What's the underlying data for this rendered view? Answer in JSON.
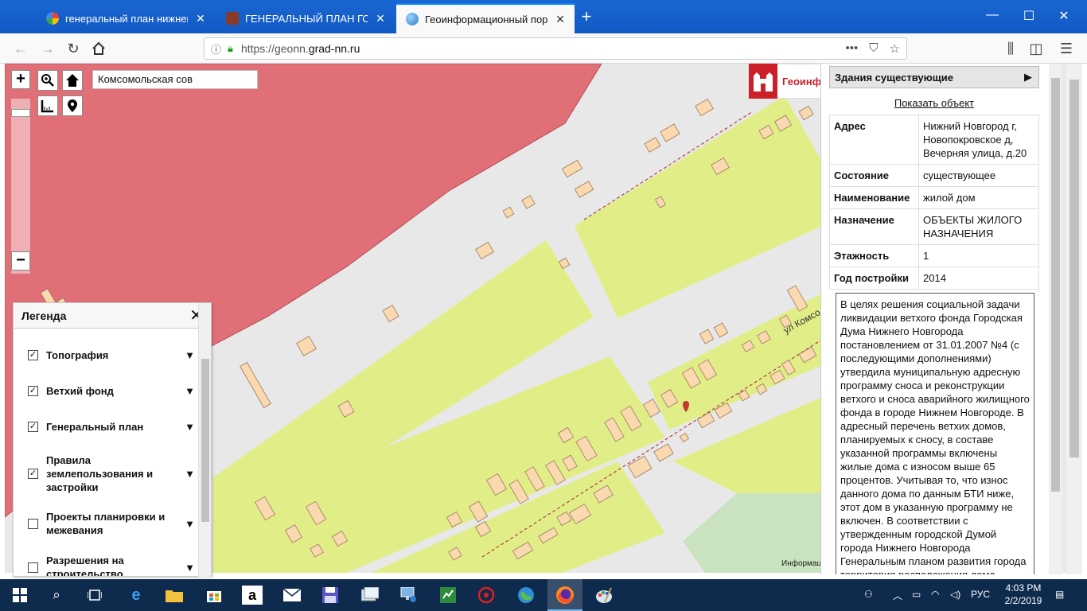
{
  "browser": {
    "tabs": [
      {
        "title": "генеральный план нижнего н",
        "icon": "google-icon"
      },
      {
        "title": "ГЕНЕРАЛЬНЫЙ ПЛАН ГОРОД",
        "icon": "site-icon"
      },
      {
        "title": "Геоинформационный портал",
        "icon": "globe-icon"
      }
    ],
    "url_prefix": "https://geonn.",
    "url_domain": "grad-nn.ru"
  },
  "map": {
    "search_value": "Комсомольская сов",
    "logo_text": "Геоинф",
    "logo_text_right": "а",
    "street_label": "ул Комсо",
    "attribution": "Информац"
  },
  "legend": {
    "title": "Легенда",
    "items": [
      {
        "label": "Топография",
        "checked": true
      },
      {
        "label": "Ветхий фонд",
        "checked": true
      },
      {
        "label": "Генеральный план",
        "checked": true
      },
      {
        "label": "Правила землепользования и застройки",
        "checked": true
      },
      {
        "label": "Проекты планировки и межевания",
        "checked": false
      },
      {
        "label": "Разрешения на строительство",
        "checked": false
      }
    ]
  },
  "panel": {
    "layer": "Здания существующие",
    "show_object": "Показать объект",
    "attributes": [
      {
        "key": "Адрес",
        "value": "Нижний Новгород г, Новопокровское д, Вечерняя улица, д.20"
      },
      {
        "key": "Состояние",
        "value": "существующее"
      },
      {
        "key": "Наименование",
        "value": "жилой дом"
      },
      {
        "key": "Назначение",
        "value": "ОБЪЕКТЫ ЖИЛОГО НАЗНАЧЕНИЯ"
      },
      {
        "key": "Этажность",
        "value": "1"
      },
      {
        "key": "Год постройки",
        "value": "2014"
      }
    ],
    "note": "В целях решения социальной задачи ликвидации ветхого фонда Городская Дума Нижнего Новгорода постановлением от 31.01.2007 №4 (с последующими дополнениями) утвердила муниципальную адресную программу сноса и реконструкции ветхого и сноса аварийного жилищного фонда в городе Нижнем Новгороде. В адресный перечень ветхих домов, планируемых к сносу, в составе указанной программы включены жилые дома с износом выше 65 процентов. Учитывая то, что износ данного дома по данным БТИ ниже, этот дом в указанную программу не включен. В соответствии с утвержденным городской Думой города Нижнего Новгорода Генеральным планом развития города территория расположения дома предусмотрена под"
  },
  "taskbar": {
    "language": "РУС",
    "time": "4:03 PM",
    "date": "2/2/2019"
  },
  "colors": {
    "zone_red": "#e16f78",
    "zone_green": "#e1ee88",
    "building": "#fbd9b0",
    "road": "#e8e8e8"
  }
}
